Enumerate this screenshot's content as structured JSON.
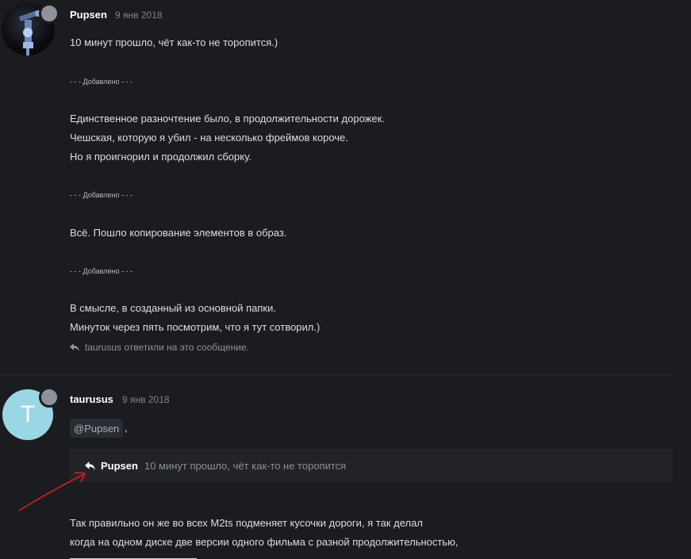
{
  "post1": {
    "username": "Pupsen",
    "date": "9 янв 2018",
    "lines": [
      "10 минут прошло, чёт как-то не торопится.)",
      "Единственное разночтение было, в продолжительности дорожек.",
      "Чешская, которую я убил - на несколько фреймов короче.",
      "Но я проигнорил и продолжил сборку.",
      "Всё. Пошло копирование элементов в образ.",
      "В смысле, в созданный из основной папки.",
      "Минуток через пять посмотрим, что я тут сотворил.)"
    ],
    "added_marker": "- - - Добавлено - - -",
    "reply_note": "taurusus ответили на это сообщение."
  },
  "post2": {
    "avatar_letter": "T",
    "username": "taurusus",
    "date": "9 янв 2018",
    "mention": "@Pupsen",
    "comma": ",",
    "quote": {
      "author": "Pupsen",
      "text": "10 минут прошло, чёт как-то не торопится"
    },
    "lines": [
      "Так правильно он же во всех M2ts подменяет кусочки дороги, я так делал",
      "когда на одном диске две версии одного фильма с разной продолжительностью,"
    ]
  },
  "colors": {
    "background": "#1b1c20",
    "avatar_t": "#9ad6e3",
    "annotation_arrow": "#d01f1f"
  },
  "icons": {
    "reply": "reply-arrow-icon",
    "status": "status-dot-icon"
  }
}
